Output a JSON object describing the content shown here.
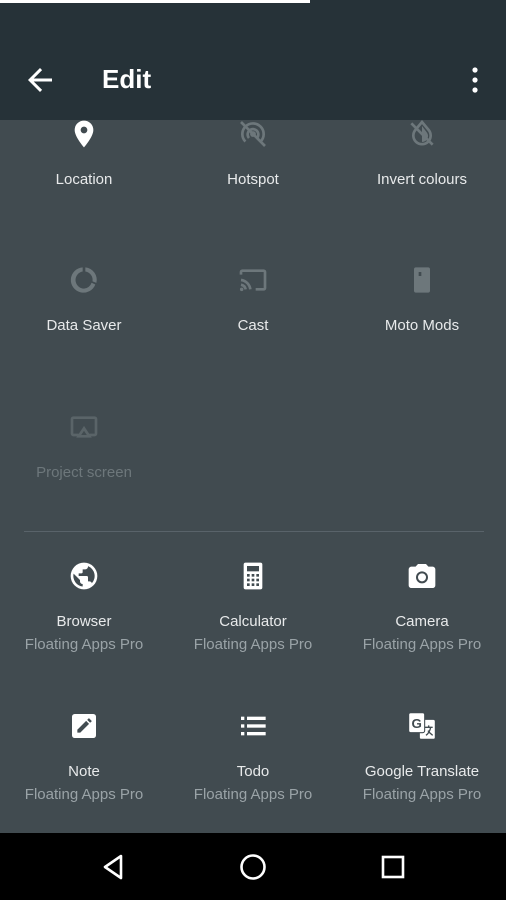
{
  "header": {
    "title": "Edit"
  },
  "active_tiles": [
    {
      "label": "Location",
      "icon": "location-pin-icon"
    },
    {
      "label": "Hotspot",
      "icon": "hotspot-icon"
    },
    {
      "label": "Invert colours",
      "icon": "invert-colours-icon"
    },
    {
      "label": "Data Saver",
      "icon": "data-saver-icon"
    },
    {
      "label": "Cast",
      "icon": "cast-icon"
    },
    {
      "label": "Moto Mods",
      "icon": "moto-mods-icon"
    },
    {
      "label": "Project screen",
      "icon": "project-screen-icon"
    }
  ],
  "available_tiles": [
    {
      "label": "Browser",
      "subtitle": "Floating Apps Pro",
      "icon": "globe-icon"
    },
    {
      "label": "Calculator",
      "subtitle": "Floating Apps Pro",
      "icon": "calculator-icon"
    },
    {
      "label": "Camera",
      "subtitle": "Floating Apps Pro",
      "icon": "camera-icon"
    },
    {
      "label": "Note",
      "subtitle": "Floating Apps Pro",
      "icon": "note-icon"
    },
    {
      "label": "Todo",
      "subtitle": "Floating Apps Pro",
      "icon": "todo-list-icon"
    },
    {
      "label": "Google Translate",
      "subtitle": "Floating Apps Pro",
      "icon": "translate-icon"
    }
  ]
}
